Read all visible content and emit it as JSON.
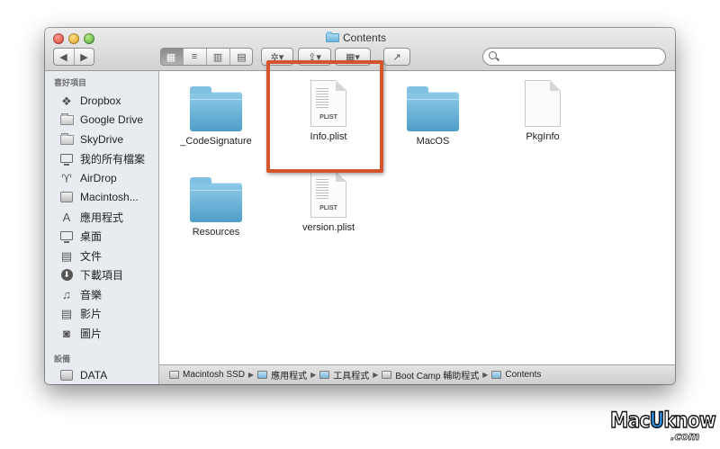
{
  "window": {
    "title": "Contents"
  },
  "toolbar": {
    "back": "◀",
    "forward": "▶",
    "view_icons": "▦",
    "view_list": "≡",
    "view_columns": "▥",
    "view_coverflow": "▤",
    "action": "✲▾",
    "share": "⇪▾",
    "arrange": "▦▾",
    "share2": "↗",
    "search_placeholder": ""
  },
  "sidebar": {
    "favorites_header": "喜好項目",
    "favorites": [
      {
        "label": "Dropbox",
        "icon": "dropbox-icon",
        "glyph": "❖"
      },
      {
        "label": "Google Drive",
        "icon": "folder-icon",
        "glyph": ""
      },
      {
        "label": "SkyDrive",
        "icon": "folder-icon",
        "glyph": ""
      },
      {
        "label": "我的所有檔案",
        "icon": "all-files-icon",
        "glyph": ""
      },
      {
        "label": "AirDrop",
        "icon": "airdrop-icon",
        "glyph": "♈"
      },
      {
        "label": "Macintosh...",
        "icon": "disk-icon",
        "glyph": ""
      },
      {
        "label": "應用程式",
        "icon": "applications-icon",
        "glyph": "A"
      },
      {
        "label": "桌面",
        "icon": "desktop-icon",
        "glyph": ""
      },
      {
        "label": "文件",
        "icon": "documents-icon",
        "glyph": "▤"
      },
      {
        "label": "下載項目",
        "icon": "downloads-icon",
        "glyph": "⬇"
      },
      {
        "label": "音樂",
        "icon": "music-icon",
        "glyph": "♫"
      },
      {
        "label": "影片",
        "icon": "movies-icon",
        "glyph": "▤"
      },
      {
        "label": "圖片",
        "icon": "pictures-icon",
        "glyph": "◙"
      }
    ],
    "devices_header": "設備",
    "devices": [
      {
        "label": "DATA",
        "icon": "disk-icon"
      }
    ]
  },
  "files": [
    {
      "name": "_CodeSignature",
      "kind": "folder"
    },
    {
      "name": "Info.plist",
      "kind": "plist",
      "tag": "PLIST"
    },
    {
      "name": "MacOS",
      "kind": "folder"
    },
    {
      "name": "PkgInfo",
      "kind": "document"
    },
    {
      "name": "Resources",
      "kind": "folder"
    },
    {
      "name": "version.plist",
      "kind": "plist",
      "tag": "PLIST"
    }
  ],
  "pathbar": {
    "segments": [
      "Macintosh SSD",
      "應用程式",
      "工具程式",
      "Boot Camp 輔助程式",
      "Contents"
    ],
    "separator": "▶"
  },
  "watermark": {
    "part1": "Mac",
    "part2": "U",
    "part3": "know",
    "sub": ".com"
  },
  "colors": {
    "highlight": "#d5542b",
    "sidebar_bg": "#e8ecf1",
    "folder_blue": "#5aa8d2"
  }
}
